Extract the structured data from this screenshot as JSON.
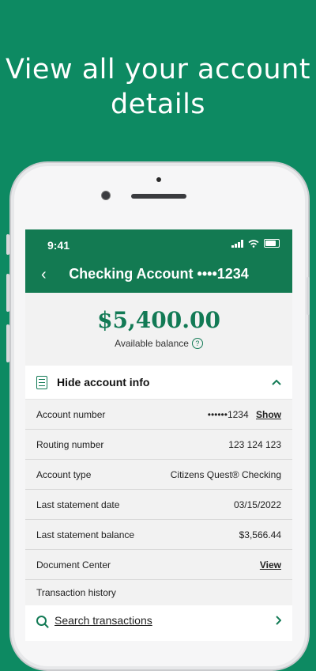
{
  "headline": {
    "line1": "View all your account",
    "line2": "details"
  },
  "status_bar": {
    "time": "9:41"
  },
  "header": {
    "back_glyph": "‹",
    "title": "Checking Account ••••1234"
  },
  "balance": {
    "amount": "$5,400.00",
    "label": "Available balance",
    "help_glyph": "?"
  },
  "account_info": {
    "toggle_label": "Hide account info",
    "rows": [
      {
        "label": "Account number",
        "value": "••••••1234",
        "action": "Show"
      },
      {
        "label": "Routing number",
        "value": "123 124 123"
      },
      {
        "label": "Account type",
        "value": "Citizens Quest® Checking"
      },
      {
        "label": "Last statement date",
        "value": "03/15/2022"
      },
      {
        "label": "Last statement balance",
        "value": "$3,566.44"
      },
      {
        "label": "Document Center",
        "action": "View"
      },
      {
        "label": "Transaction history"
      }
    ]
  },
  "search": {
    "label": "Search transactions"
  },
  "icons": {
    "doc": "document-icon",
    "chev_up": "chevron-up-icon",
    "chev_right": "chevron-right-icon",
    "search": "search-icon"
  },
  "colors": {
    "brand_green": "#0d8a62",
    "header_green": "#137a52",
    "amount_green": "#127a55"
  }
}
